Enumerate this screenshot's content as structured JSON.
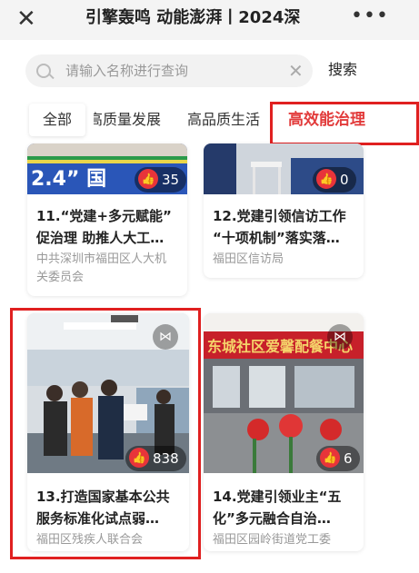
{
  "header": {
    "close_icon": "close-icon",
    "title": "引擎轰鸣 动能澎湃丨2024深",
    "more_icon": "more-icon"
  },
  "search": {
    "placeholder": "请输入名称进行查询",
    "value": "",
    "button_label": "搜索"
  },
  "tabs": [
    {
      "label": "全部"
    },
    {
      "label": "高质量发展"
    },
    {
      "label": "高品质生活"
    },
    {
      "label": "高效能治理",
      "active": true
    }
  ],
  "cards": [
    {
      "caption_line1": "11.“党建+多元赋能”",
      "caption_line2": "促治理 助推人大工…",
      "org_line1": "中共深圳市福田区人大机",
      "org_line2": "关委员会",
      "likes": "35",
      "photo_text": "2.4” 国"
    },
    {
      "caption_line1": "12.党建引领信访工作",
      "caption_line2": "“十项机制”落实落…",
      "org_line1": "福田区信访局",
      "likes": "0"
    },
    {
      "caption_line1": "13.打造国家基本公共",
      "caption_line2": "服务标准化试点弱…",
      "org_line1": "福田区残疾人联合会",
      "likes": "838"
    },
    {
      "caption_line1": "14.党建引领业主“五",
      "caption_line2": "化”多元融合自治…",
      "org_line1": "福田区园岭街道党工委",
      "likes": "6",
      "photo_text": "东城社区爱馨配餐中心"
    }
  ],
  "colors": {
    "active_tab": "#e23b3b",
    "highlight_box": "#e02020",
    "like_badge": "#e8343a"
  }
}
